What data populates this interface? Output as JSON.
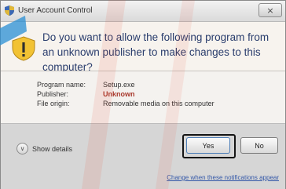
{
  "window": {
    "title": "User Account Control",
    "close_glyph": "×"
  },
  "header": {
    "question": "Do you want to allow the following program from an unknown publisher to make changes to this computer?",
    "icon": "shield-warning-icon"
  },
  "details": {
    "rows": [
      {
        "label": "Program name:",
        "value": "Setup.exe"
      },
      {
        "label": "Publisher:",
        "value": "Unknown"
      },
      {
        "label": "File origin:",
        "value": "Removable media on this computer"
      }
    ]
  },
  "footer": {
    "show_details_label": "Show details",
    "yes_label": "Yes",
    "no_label": "No",
    "change_link": "Change when these notifications appear"
  },
  "colors": {
    "question_text": "#2a3d6d",
    "publisher_unknown": "#a8382c",
    "link": "#3458a8"
  }
}
